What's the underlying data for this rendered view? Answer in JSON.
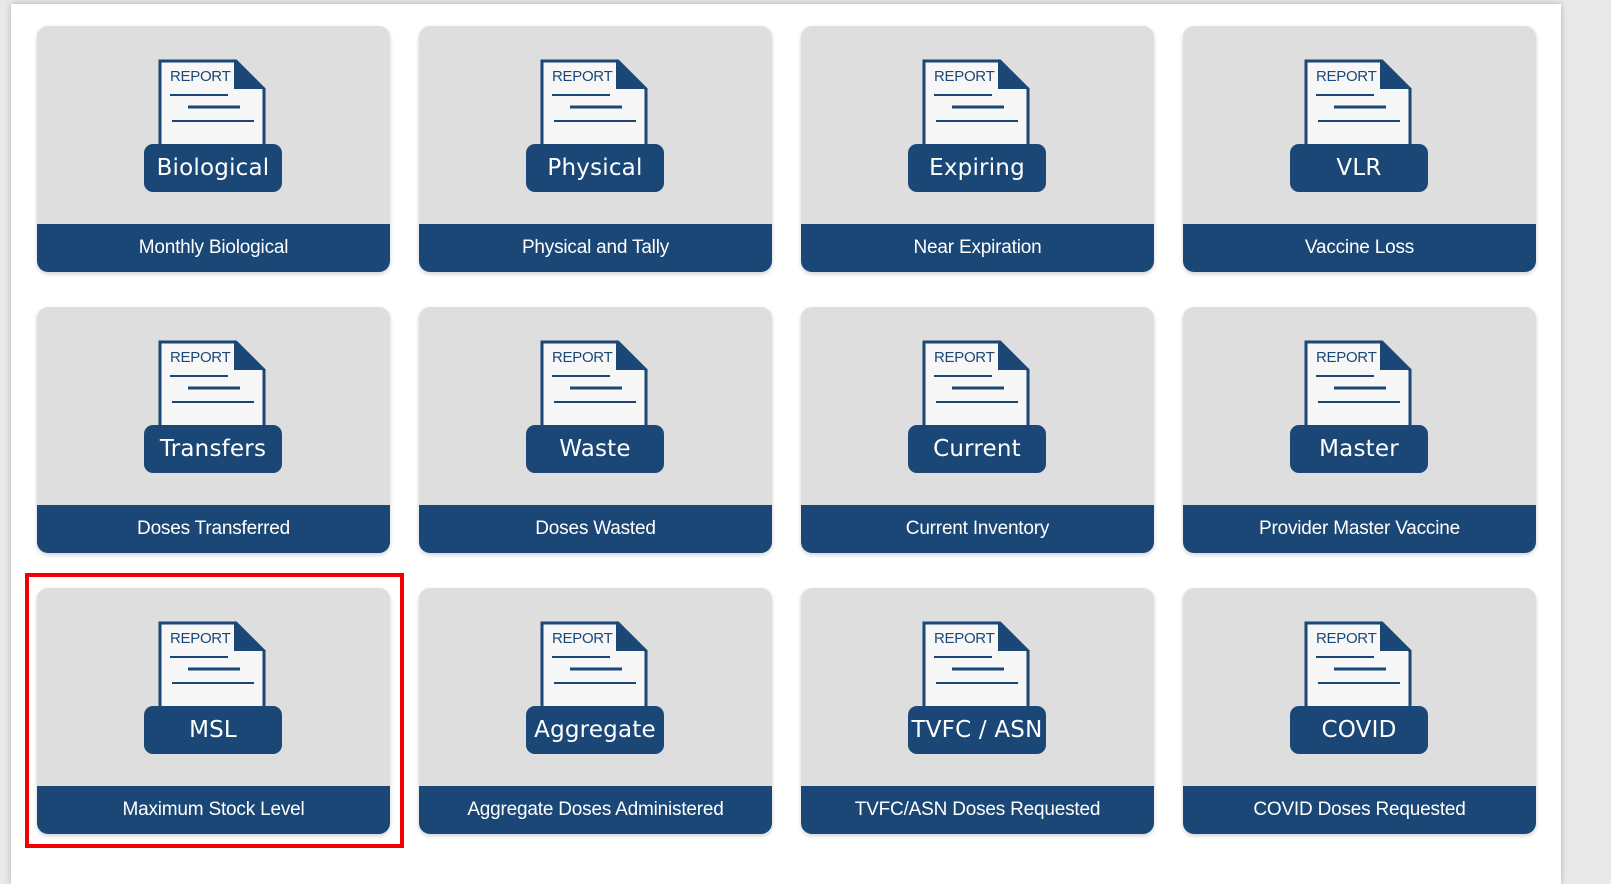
{
  "doc_word": "REPORT",
  "colors": {
    "accent": "#1b4776",
    "tile_bg": "#dedede",
    "highlight": "#f00000"
  },
  "tiles": [
    {
      "id": "monthly-biological",
      "badge": "Biological",
      "title": "Monthly Biological"
    },
    {
      "id": "physical-and-tally",
      "badge": "Physical",
      "title": "Physical and Tally"
    },
    {
      "id": "near-expiration",
      "badge": "Expiring",
      "title": "Near Expiration"
    },
    {
      "id": "vaccine-loss",
      "badge": "VLR",
      "title": "Vaccine Loss"
    },
    {
      "id": "doses-transferred",
      "badge": "Transfers",
      "title": "Doses Transferred"
    },
    {
      "id": "doses-wasted",
      "badge": "Waste",
      "title": "Doses Wasted"
    },
    {
      "id": "current-inventory",
      "badge": "Current",
      "title": "Current Inventory"
    },
    {
      "id": "provider-master-vaccine",
      "badge": "Master",
      "title": "Provider Master Vaccine"
    },
    {
      "id": "maximum-stock-level",
      "badge": "MSL",
      "title": "Maximum Stock Level"
    },
    {
      "id": "aggregate-doses-administered",
      "badge": "Aggregate",
      "title": "Aggregate Doses Administered"
    },
    {
      "id": "tvfc-asn-doses-requested",
      "badge": "TVFC / ASN",
      "title": "TVFC/ASN Doses Requested"
    },
    {
      "id": "covid-doses-requested",
      "badge": "COVID",
      "title": "COVID Doses Requested"
    }
  ],
  "highlighted_tile": "maximum-stock-level"
}
